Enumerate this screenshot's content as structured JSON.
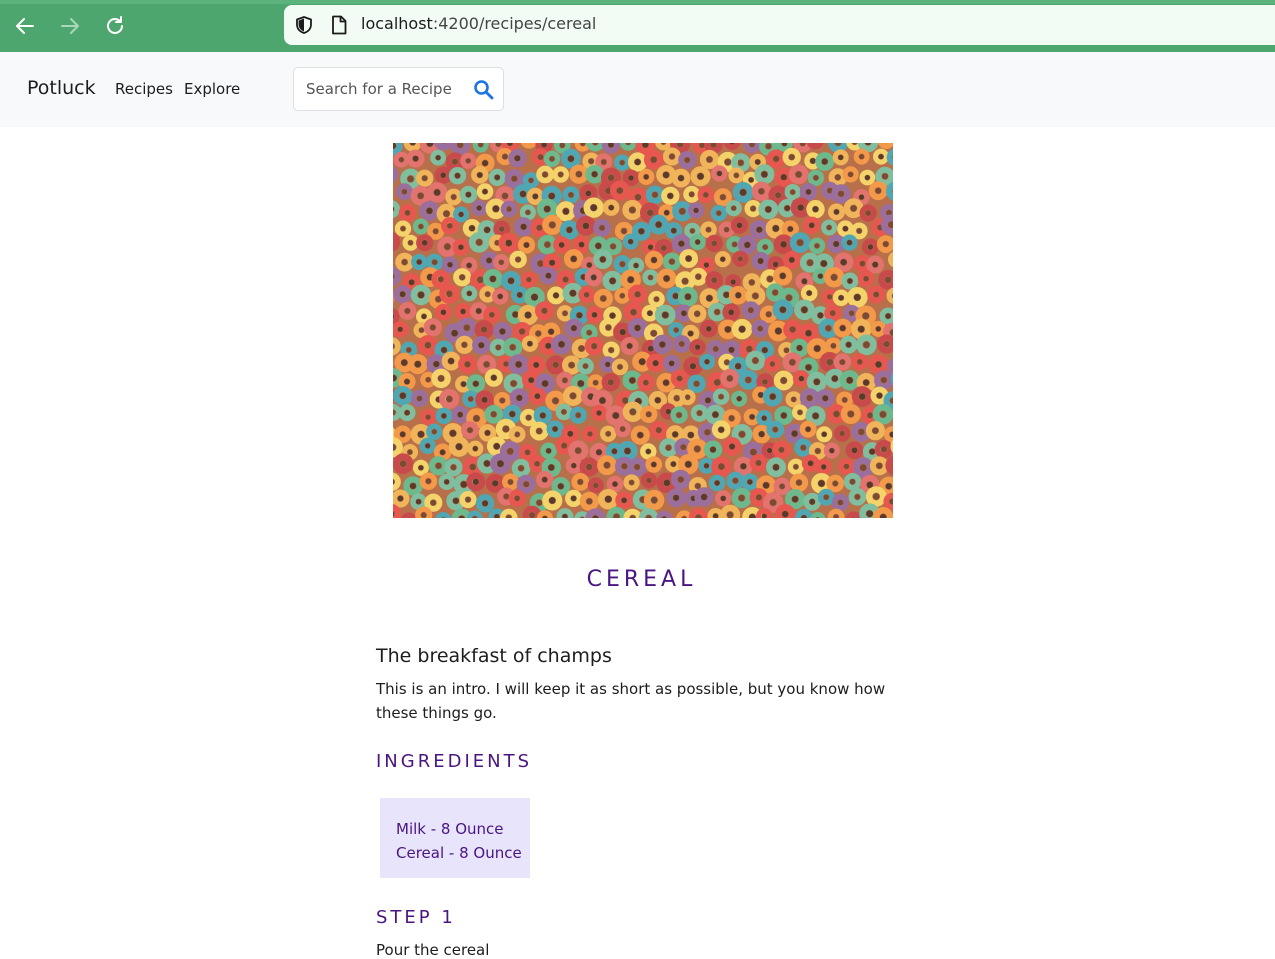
{
  "browser": {
    "url_host": "localhost",
    "url_rest": ":4200/recipes/cereal",
    "accent_color": "#4ea66f"
  },
  "navbar": {
    "brand": "Potluck",
    "links": [
      "Recipes",
      "Explore"
    ],
    "search_placeholder": "Search for a Recipe"
  },
  "recipe": {
    "title": "CEREAL",
    "subtitle": "The breakfast of champs",
    "intro": "This is an intro. I will keep it as short as possible, but you know how these things go.",
    "ingredients_heading": "INGREDIENTS",
    "ingredients": [
      "Milk - 8 Ounce",
      "Cereal - 8 Ounce"
    ],
    "steps": [
      {
        "heading": "STEP 1",
        "text": "Pour the cereal"
      }
    ]
  },
  "colors": {
    "heading": "#4a1580",
    "ingredients_bg": "#e8e4fb",
    "navbar_bg": "#f8f9fa"
  }
}
